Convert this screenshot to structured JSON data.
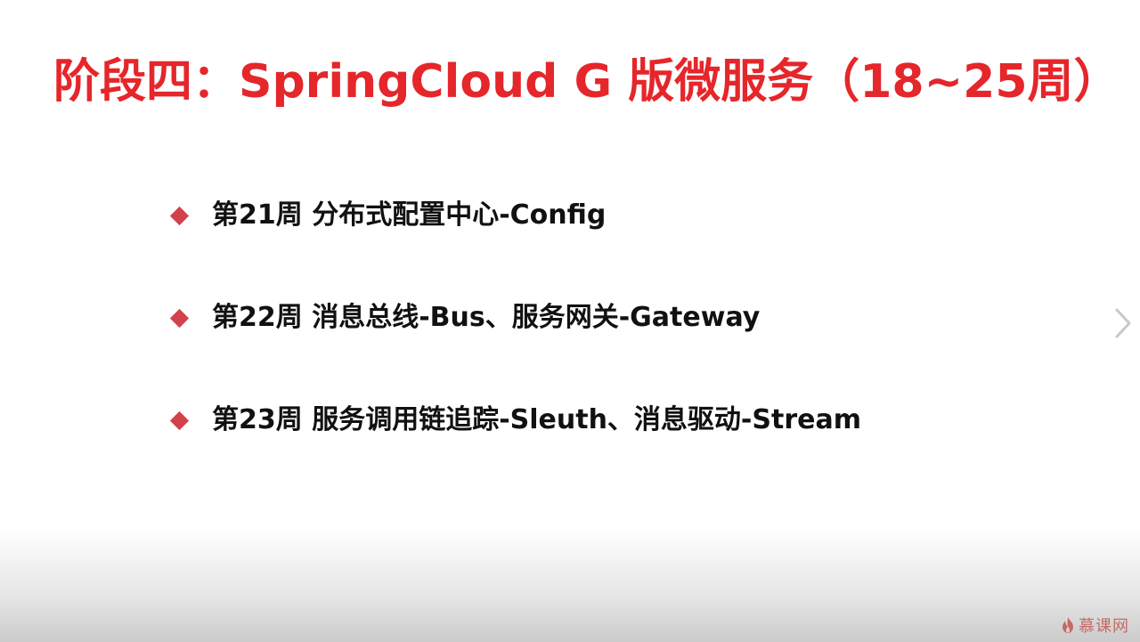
{
  "slide": {
    "title": "阶段四：SpringCloud G 版微服务（18~25周）",
    "items": [
      {
        "text": "第21周 分布式配置中心-Config"
      },
      {
        "text": "第22周 消息总线-Bus、服务网关-Gateway"
      },
      {
        "text": "第23周 服务调用链追踪-Sleuth、消息驱动-Stream"
      }
    ]
  },
  "navigation": {
    "next_icon": "chevron-right-icon"
  },
  "watermark": {
    "text": "慕课网",
    "icon": "flame-logo-icon"
  },
  "colors": {
    "title": "#e5262a",
    "bullet": "#d2424c",
    "text": "#111111",
    "watermark": "#c0504a"
  }
}
